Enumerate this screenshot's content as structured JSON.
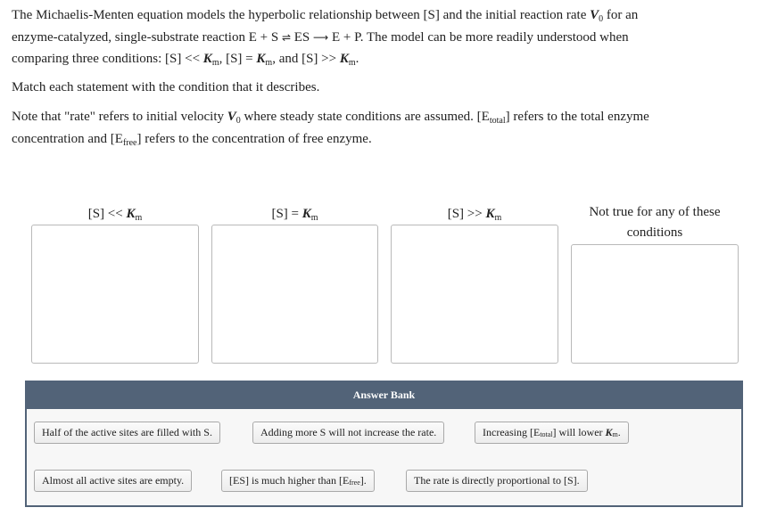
{
  "intro": {
    "line1_a": "The Michaelis-Menten equation models the hyperbolic relationship between [S] and the initial reaction rate ",
    "v0_sym": "V",
    "v0_sub": "0",
    "line1_b": " for an",
    "line2_a": "enzyme-catalyzed, single-substrate reaction E + S ",
    "equilibrium_arrow": "⇌",
    "line2_b": " ES ",
    "forward_arrow": "⟶",
    "line2_c": " E + P. The model can be more readily understood when",
    "line3_a": "comparing three conditions: [S] << ",
    "km_sym": "K",
    "km_sub": "m",
    "line3_b": ", [S] = ",
    "line3_c": ", and [S] >> ",
    "line3_d": "."
  },
  "instruction": "Match each statement with the condition that it describes.",
  "note": {
    "a": "Note that \"rate\" refers to initial velocity ",
    "b": " where steady state conditions are assumed. [E",
    "total_sub": "total",
    "c": "] refers to the total enzyme",
    "d": "concentration and [E",
    "free_sub": "free",
    "e": "] refers to the concentration of free enzyme."
  },
  "targets": [
    {
      "prefix": "[S] << ",
      "sym": "K",
      "sub": "m"
    },
    {
      "prefix": "[S] = ",
      "sym": "K",
      "sub": "m"
    },
    {
      "prefix": "[S] >> ",
      "sym": "K",
      "sub": "m"
    },
    {
      "label_line1": "Not true for any of these",
      "label_line2": "conditions"
    }
  ],
  "answer_bank": {
    "title": "Answer Bank",
    "items": [
      {
        "text": "Half of the active sites are filled with S."
      },
      {
        "text": "Adding more S will not increase the rate."
      },
      {
        "pre": "Increasing [E",
        "sub": "total",
        "mid": "] will lower ",
        "sym": "K",
        "sym_sub": "m",
        "post": "."
      },
      {
        "text": "Almost all active sites are empty."
      },
      {
        "pre": "[ES] is much higher than [E",
        "sub": "free",
        "post": "]."
      },
      {
        "text": "The rate is directly proportional to [S]."
      }
    ]
  },
  "colors": {
    "bank_header": "#526378",
    "bank_body": "#f7f7f7",
    "drop_border": "#b9b9b9"
  }
}
